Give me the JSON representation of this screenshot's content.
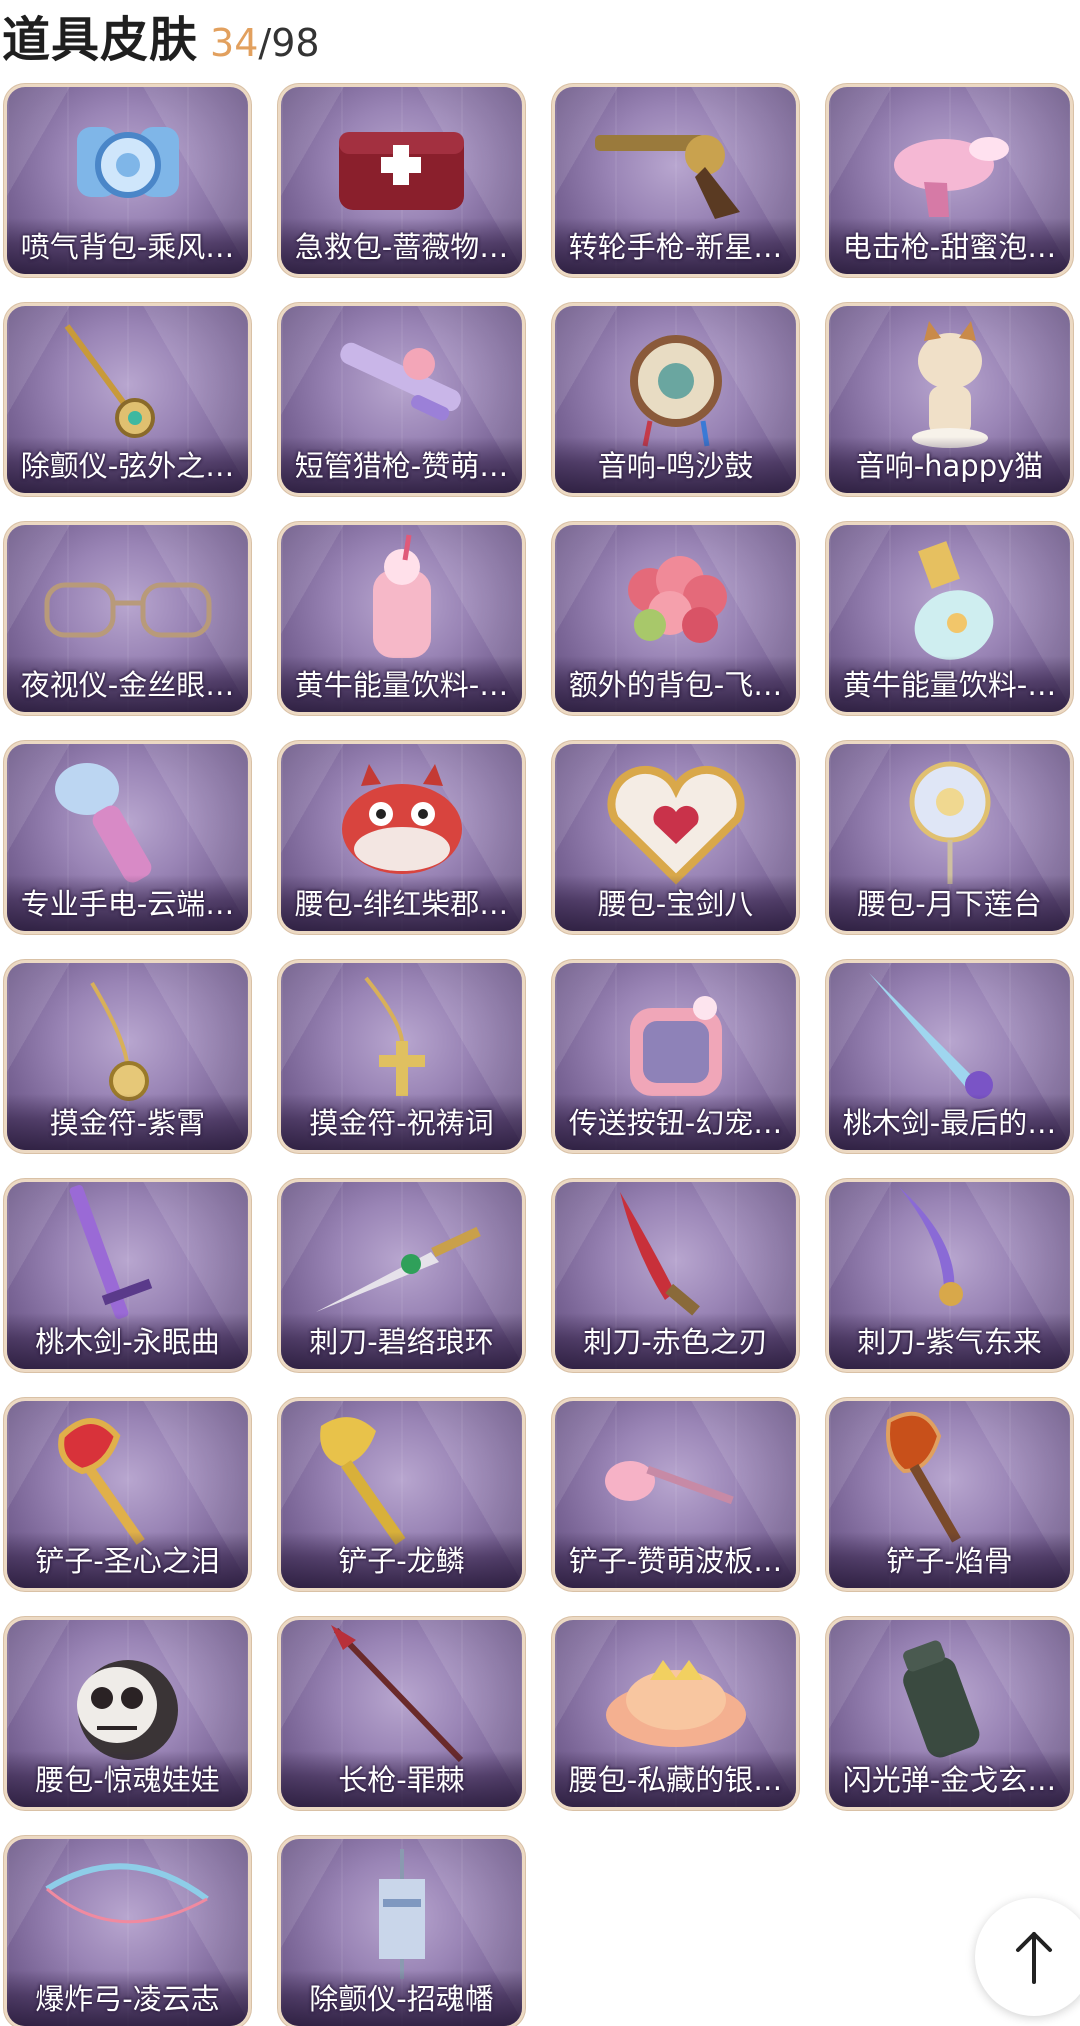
{
  "header": {
    "title": "道具皮肤",
    "owned": "34",
    "separator": "/",
    "total": "98"
  },
  "colors": {
    "accent_count": "#e2a05e",
    "card_border": "#ecd9c3",
    "card_bg": "#9a85b6"
  },
  "items": [
    {
      "label": "喷气背包-乘风…",
      "icon": "jetpack-icon"
    },
    {
      "label": "急救包-蔷薇物…",
      "icon": "medkit-icon"
    },
    {
      "label": "转轮手枪-新星…",
      "icon": "revolver-icon"
    },
    {
      "label": "电击枪-甜蜜泡…",
      "icon": "stun-gun-icon"
    },
    {
      "label": "除颤仪-弦外之…",
      "icon": "defibrillator-icon"
    },
    {
      "label": "短管猎枪-赞萌…",
      "icon": "shotgun-icon"
    },
    {
      "label": "音响-鸣沙鼓",
      "icon": "drum-speaker-icon"
    },
    {
      "label": "音响-happy猫",
      "icon": "cat-speaker-icon"
    },
    {
      "label": "夜视仪-金丝眼…",
      "icon": "glasses-icon"
    },
    {
      "label": "黄牛能量饮料-…",
      "icon": "drink-icon"
    },
    {
      "label": "额外的背包-飞…",
      "icon": "flower-backpack-icon"
    },
    {
      "label": "黄牛能量饮料-…",
      "icon": "bottle-icon"
    },
    {
      "label": "专业手电-云端…",
      "icon": "flashlight-icon"
    },
    {
      "label": "腰包-绯红柴郡…",
      "icon": "cheshire-bag-icon"
    },
    {
      "label": "腰包-宝剑八",
      "icon": "heart-bag-icon"
    },
    {
      "label": "腰包-月下莲台",
      "icon": "lotus-bag-icon"
    },
    {
      "label": "摸金符-紫霄",
      "icon": "amulet-icon"
    },
    {
      "label": "摸金符-祝祷词",
      "icon": "cross-amulet-icon"
    },
    {
      "label": "传送按钮-幻宠…",
      "icon": "teleport-button-icon"
    },
    {
      "label": "桃木剑-最后的…",
      "icon": "horn-sword-icon"
    },
    {
      "label": "桃木剑-永眠曲",
      "icon": "purple-sword-icon"
    },
    {
      "label": "刺刀-碧络琅环",
      "icon": "dagger-icon"
    },
    {
      "label": "刺刀-赤色之刃",
      "icon": "red-blade-icon"
    },
    {
      "label": "刺刀-紫气东来",
      "icon": "purple-blade-icon"
    },
    {
      "label": "铲子-圣心之泪",
      "icon": "ruby-shovel-icon"
    },
    {
      "label": "铲子-龙鳞",
      "icon": "gold-shovel-icon"
    },
    {
      "label": "铲子-赞萌波板…",
      "icon": "pink-shovel-icon"
    },
    {
      "label": "铲子-焰骨",
      "icon": "flame-shovel-icon"
    },
    {
      "label": "腰包-惊魂娃娃",
      "icon": "skull-doll-icon"
    },
    {
      "label": "长枪-罪棘",
      "icon": "spear-icon"
    },
    {
      "label": "腰包-私藏的银…",
      "icon": "cloud-bag-icon"
    },
    {
      "label": "闪光弹-金戈玄…",
      "icon": "flashbang-icon"
    },
    {
      "label": "爆炸弓-凌云志",
      "icon": "bow-icon"
    },
    {
      "label": "除颤仪-招魂幡",
      "icon": "banner-icon"
    }
  ],
  "scroll_top": {
    "icon": "arrow-up-icon"
  }
}
